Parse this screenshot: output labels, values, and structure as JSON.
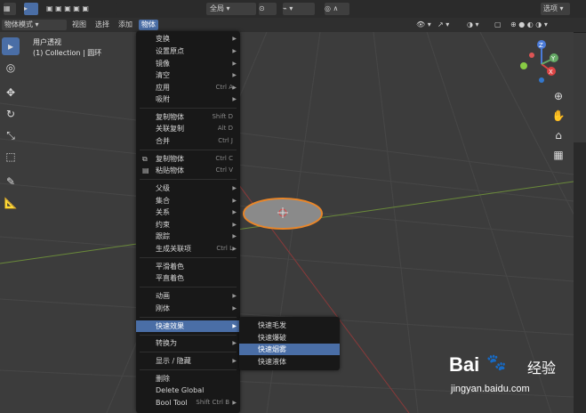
{
  "topbar": {
    "orientation_label": "全局",
    "options_label": "选项"
  },
  "header": {
    "mode_label": "物体模式",
    "menus": [
      "视图",
      "选择",
      "添加",
      "物体"
    ]
  },
  "viewport": {
    "view_name": "用户透视",
    "collection_info": "(1) Collection | 圆环"
  },
  "object_menu": {
    "items": [
      {
        "label": "变换",
        "submenu": true
      },
      {
        "label": "设置原点",
        "submenu": true
      },
      {
        "label": "镜像",
        "submenu": true
      },
      {
        "label": "清空",
        "submenu": true
      },
      {
        "label": "应用",
        "shortcut": "Ctrl A",
        "submenu": true
      },
      {
        "label": "吸附",
        "submenu": true
      },
      {
        "label": "复制物体",
        "shortcut": "Shift D"
      },
      {
        "label": "关联复制",
        "shortcut": "Alt D"
      },
      {
        "label": "合并",
        "shortcut": "Ctrl J"
      },
      {
        "label": "复制物体",
        "shortcut": "Ctrl C",
        "icon": "copy-icon"
      },
      {
        "label": "粘贴物体",
        "shortcut": "Ctrl V",
        "icon": "paste-icon"
      },
      {
        "label": "父级",
        "submenu": true
      },
      {
        "label": "集合",
        "submenu": true
      },
      {
        "label": "关系",
        "submenu": true
      },
      {
        "label": "约束",
        "submenu": true
      },
      {
        "label": "跟踪",
        "submenu": true
      },
      {
        "label": "生成关联项",
        "shortcut": "Ctrl L",
        "submenu": true
      },
      {
        "label": "平滑着色"
      },
      {
        "label": "平直着色"
      },
      {
        "label": "动画",
        "submenu": true
      },
      {
        "label": "刚体",
        "submenu": true
      },
      {
        "label": "快速效果",
        "submenu": true,
        "highlighted": true
      },
      {
        "label": "转换为",
        "submenu": true
      },
      {
        "label": "显示 / 隐藏",
        "submenu": true
      },
      {
        "label": "删除"
      },
      {
        "label": "Delete Global"
      },
      {
        "label": "Bool Tool",
        "shortcut": "Shift Ctrl B",
        "submenu": true
      }
    ]
  },
  "quick_effects_submenu": {
    "items": [
      {
        "label": "快速毛发"
      },
      {
        "label": "快速爆破"
      },
      {
        "label": "快速烟雾",
        "highlighted": true
      },
      {
        "label": "快速液体"
      }
    ]
  },
  "gizmo": {
    "x": "X",
    "y": "Y",
    "z": "Z"
  },
  "watermark": {
    "brand": "Bai",
    "brand2": "经验",
    "url": "jingyan.baidu.com"
  },
  "colors": {
    "accent": "#4a6ea6",
    "menu_bg": "#181818",
    "selection_outline": "#e8862a"
  }
}
